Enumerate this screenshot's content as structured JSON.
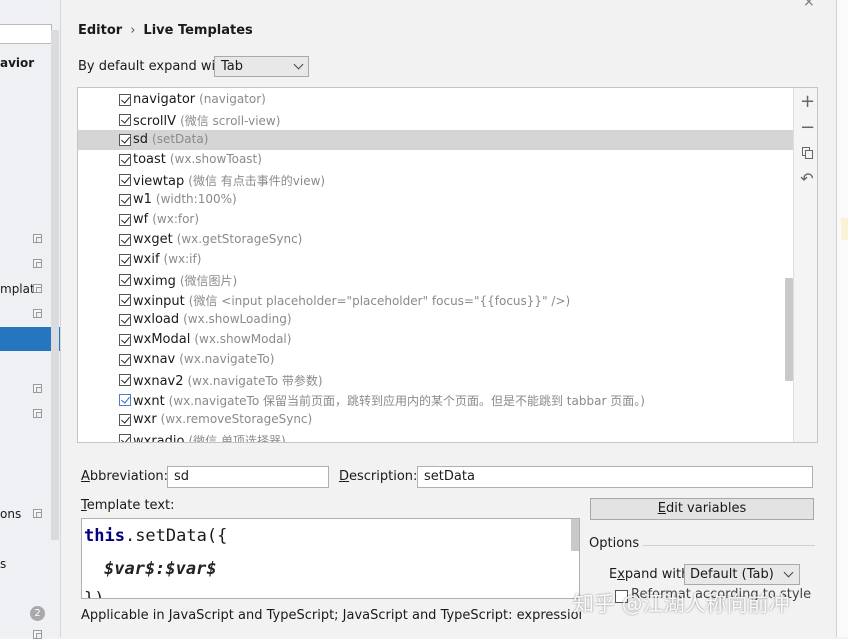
{
  "sidebar": {
    "labels": [
      "avior",
      "mplat",
      "ons",
      "s"
    ],
    "badge": "2"
  },
  "header": {
    "breadcrumb_parent": "Editor",
    "breadcrumb_separator": "›",
    "breadcrumb_current": "Live Templates"
  },
  "expand": {
    "label": "By default expand with",
    "value": "Tab"
  },
  "templates": [
    {
      "abbr": "navigator",
      "desc": "(navigator)"
    },
    {
      "abbr": "scrollV",
      "desc": "(微信 scroll-view)"
    },
    {
      "abbr": "sd",
      "desc": "(setData)"
    },
    {
      "abbr": "toast",
      "desc": "(wx.showToast)"
    },
    {
      "abbr": "viewtap",
      "desc": "(微信 有点击事件的view)"
    },
    {
      "abbr": "w1",
      "desc": "(width:100%)"
    },
    {
      "abbr": "wf",
      "desc": "(wx:for)"
    },
    {
      "abbr": "wxget",
      "desc": "(wx.getStorageSync)"
    },
    {
      "abbr": "wxif",
      "desc": "(wx:if)"
    },
    {
      "abbr": "wximg",
      "desc": "(微信图片)"
    },
    {
      "abbr": "wxinput",
      "desc": "(微信 <input placeholder=\"placeholder\" focus=\"{{focus}}\" />)"
    },
    {
      "abbr": "wxload",
      "desc": "(wx.showLoading)"
    },
    {
      "abbr": "wxModal",
      "desc": "(wx.showModal)"
    },
    {
      "abbr": "wxnav",
      "desc": "(wx.navigateTo)"
    },
    {
      "abbr": "wxnav2",
      "desc": "(wx.navigateTo 带参数)"
    },
    {
      "abbr": "wxnt",
      "desc": "(wx.navigateTo 保留当前页面，跳转到应用内的某个页面。但是不能跳到 tabbar 页面。)"
    },
    {
      "abbr": "wxr",
      "desc": "(wx.removeStorageSync)"
    },
    {
      "abbr": "wxradio",
      "desc": "(微信 单项选择器)"
    }
  ],
  "selected_index": 2,
  "toolbar": {
    "add": "+",
    "remove": "−",
    "restore": "↶"
  },
  "form": {
    "abbreviation_label_u": "A",
    "abbreviation_label_rest": "bbreviation:",
    "abbreviation_value": "sd",
    "description_label_u": "D",
    "description_label_rest": "escription:",
    "description_value": "setData",
    "template_label_u": "T",
    "template_label_rest": "emplate text:",
    "code_kw": "this",
    "code_line1_rest": ".setData({",
    "code_line2": "$var$:$var$",
    "code_line3": "})",
    "edit_vars_u": "E",
    "edit_vars_rest": "dit variables",
    "options_title": "Options",
    "expand_with_u": "x",
    "expand_with_pre": "E",
    "expand_with_rest": "pand with",
    "expand_with_value": "Default (Tab)",
    "reformat_label": "Reformat according to style",
    "applicable": "Applicable in JavaScript and TypeScript; JavaScript and TypeScript: expression, JSX HT"
  },
  "watermark": "知乎 @江湖人称向前冲"
}
